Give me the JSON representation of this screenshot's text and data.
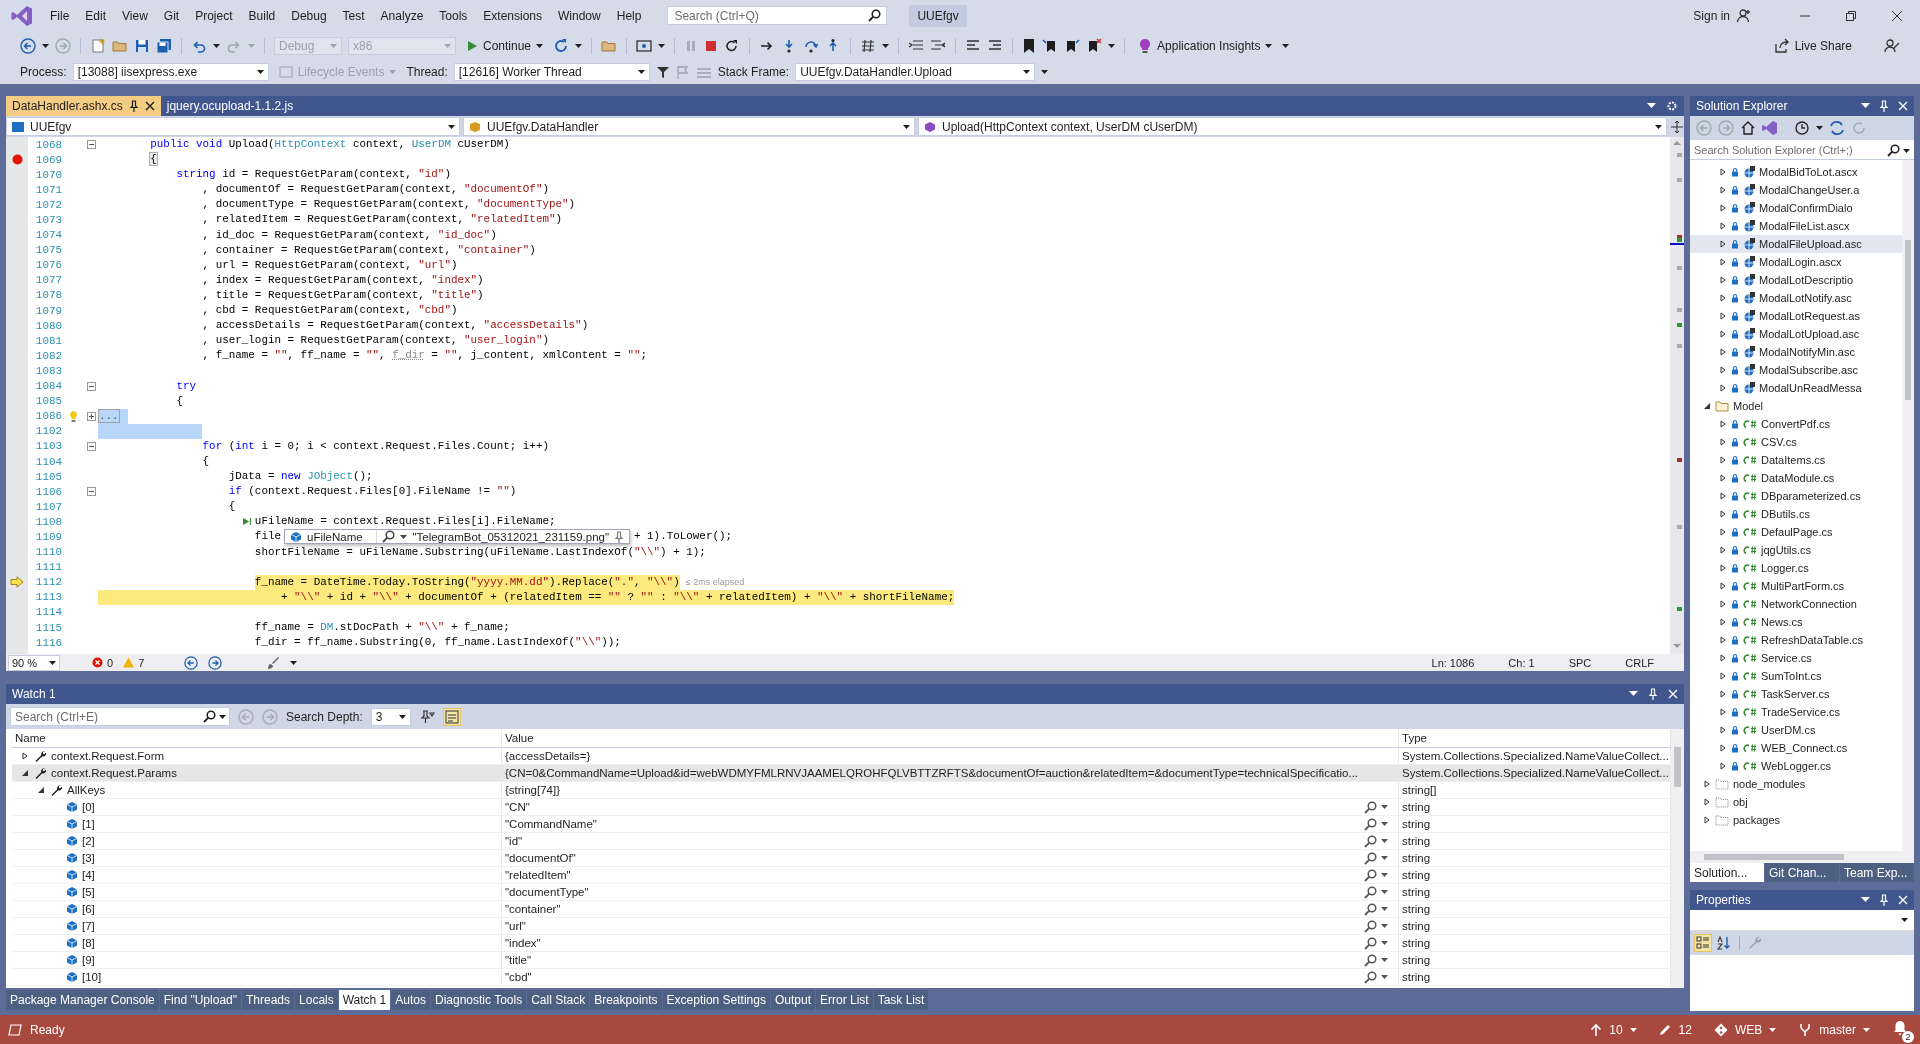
{
  "menubar": {
    "items": [
      "File",
      "Edit",
      "View",
      "Git",
      "Project",
      "Build",
      "Debug",
      "Test",
      "Analyze",
      "Tools",
      "Extensions",
      "Window",
      "Help"
    ],
    "search": {
      "placeholder": "Search (Ctrl+Q)"
    },
    "solution_name": "UUEfgv",
    "sign_in": "Sign in"
  },
  "toolbar": {
    "configuration": {
      "value": "Debug",
      "disabled": true
    },
    "platform": {
      "value": "x86",
      "disabled": true
    },
    "continue": "Continue",
    "application_insights": "Application Insights",
    "live_share": "Live Share"
  },
  "debug_location": {
    "process_label": "Process:",
    "process": "[13088] iisexpress.exe",
    "lifecycle_events": {
      "label": "Lifecycle Events",
      "disabled": true
    },
    "thread_label": "Thread:",
    "thread": "[12616] Worker Thread",
    "stack_frame_label": "Stack Frame:",
    "stack_frame": "UUEfgv.DataHandler.Upload"
  },
  "document_tabs": [
    {
      "label": "DataHandler.ashx.cs",
      "selected": true
    },
    {
      "label": "jquery.ocupload-1.1.2.js",
      "selected": false
    }
  ],
  "navigation_bar": [
    "UUEfgv",
    "UUEfgv.DataHandler",
    "Upload(HttpContext context, UserDM cUserDM)"
  ],
  "editor": {
    "lines": [
      {
        "number": "1068",
        "kind": "plain",
        "current": false,
        "selected": false,
        "expanded": true,
        "tokens": [
          {
            "kind": "k",
            "text": "        public void"
          },
          {
            "kind": "p",
            "text": " Upload("
          },
          {
            "kind": "t",
            "text": "HttpContext"
          },
          {
            "kind": "p",
            "text": " context, "
          },
          {
            "kind": "t",
            "text": "UserDM"
          },
          {
            "kind": "p",
            "text": " cUserDM)"
          }
        ]
      },
      {
        "number": "1069",
        "kind": "breakpoint",
        "current": false,
        "selected": false,
        "tokens": [
          {
            "kind": "m",
            "text": "        {"
          }
        ]
      },
      {
        "number": "1070",
        "kind": "plain",
        "current": false,
        "selected": false,
        "tokens": [
          {
            "kind": "k",
            "text": "            string"
          },
          {
            "kind": "p",
            "text": " id = RequestGetParam(context, "
          },
          {
            "kind": "s",
            "text": "\"id\""
          },
          {
            "kind": "p",
            "text": ")"
          }
        ]
      },
      {
        "number": "1071",
        "kind": "plain",
        "current": false,
        "selected": false,
        "tokens": [
          {
            "kind": "p",
            "text": "                , documentOf = RequestGetParam(context, "
          },
          {
            "kind": "s",
            "text": "\"documentOf\""
          },
          {
            "kind": "p",
            "text": ")"
          }
        ]
      },
      {
        "number": "1072",
        "kind": "plain",
        "current": false,
        "selected": false,
        "tokens": [
          {
            "kind": "p",
            "text": "                , documentType = RequestGetParam(context, "
          },
          {
            "kind": "s",
            "text": "\"documentType\""
          },
          {
            "kind": "p",
            "text": ")"
          }
        ]
      },
      {
        "number": "1073",
        "kind": "plain",
        "current": false,
        "selected": false,
        "tokens": [
          {
            "kind": "p",
            "text": "                , relatedItem = RequestGetParam(context, "
          },
          {
            "kind": "s",
            "text": "\"relatedItem\""
          },
          {
            "kind": "p",
            "text": ")"
          }
        ]
      },
      {
        "number": "1074",
        "kind": "plain",
        "current": false,
        "selected": false,
        "tokens": [
          {
            "kind": "p",
            "text": "                , id_doc = RequestGetParam(context, "
          },
          {
            "kind": "s",
            "text": "\"id_doc\""
          },
          {
            "kind": "p",
            "text": ")"
          }
        ]
      },
      {
        "number": "1075",
        "kind": "plain",
        "current": false,
        "selected": false,
        "tokens": [
          {
            "kind": "p",
            "text": "                , container = RequestGetParam(context, "
          },
          {
            "kind": "s",
            "text": "\"container\""
          },
          {
            "kind": "p",
            "text": ")"
          }
        ]
      },
      {
        "number": "1076",
        "kind": "plain",
        "current": false,
        "selected": false,
        "tokens": [
          {
            "kind": "p",
            "text": "                , url = RequestGetParam(context, "
          },
          {
            "kind": "s",
            "text": "\"url\""
          },
          {
            "kind": "p",
            "text": ")"
          }
        ]
      },
      {
        "number": "1077",
        "kind": "plain",
        "current": false,
        "selected": false,
        "tokens": [
          {
            "kind": "p",
            "text": "                , index = RequestGetParam(context, "
          },
          {
            "kind": "s",
            "text": "\"index\""
          },
          {
            "kind": "p",
            "text": ")"
          }
        ]
      },
      {
        "number": "1078",
        "kind": "plain",
        "current": false,
        "selected": false,
        "tokens": [
          {
            "kind": "p",
            "text": "                , title = RequestGetParam(context, "
          },
          {
            "kind": "s",
            "text": "\"title\""
          },
          {
            "kind": "p",
            "text": ")"
          }
        ]
      },
      {
        "number": "1079",
        "kind": "plain",
        "current": false,
        "selected": false,
        "tokens": [
          {
            "kind": "p",
            "text": "                , cbd = RequestGetParam(context, "
          },
          {
            "kind": "s",
            "text": "\"cbd\""
          },
          {
            "kind": "p",
            "text": ")"
          }
        ]
      },
      {
        "number": "1080",
        "kind": "plain",
        "current": false,
        "selected": false,
        "tokens": [
          {
            "kind": "p",
            "text": "                , accessDetails = RequestGetParam(context, "
          },
          {
            "kind": "s",
            "text": "\"accessDetails\""
          },
          {
            "kind": "p",
            "text": ")"
          }
        ]
      },
      {
        "number": "1081",
        "kind": "plain",
        "current": false,
        "selected": false,
        "tokens": [
          {
            "kind": "p",
            "text": "                , user_login = RequestGetParam(context, "
          },
          {
            "kind": "s",
            "text": "\"user_login\""
          },
          {
            "kind": "p",
            "text": ")"
          }
        ]
      },
      {
        "number": "1082",
        "kind": "plain",
        "current": false,
        "selected": false,
        "tokens": [
          {
            "kind": "p",
            "text": "                , f_name = "
          },
          {
            "kind": "s",
            "text": "\"\""
          },
          {
            "kind": "p",
            "text": ", ff_name = "
          },
          {
            "kind": "s",
            "text": "\"\""
          },
          {
            "kind": "p",
            "text": ", "
          },
          {
            "kind": "u",
            "text": "f_dir"
          },
          {
            "kind": "p",
            "text": " = "
          },
          {
            "kind": "s",
            "text": "\"\""
          },
          {
            "kind": "p",
            "text": ", j_content, xmlContent = "
          },
          {
            "kind": "s",
            "text": "\"\""
          },
          {
            "kind": "p",
            "text": ";"
          }
        ]
      },
      {
        "number": "1083",
        "kind": "plain",
        "current": false,
        "selected": false
      },
      {
        "number": "1084",
        "kind": "plain",
        "current": false,
        "selected": false,
        "expanded": true,
        "tokens": [
          {
            "kind": "k",
            "text": "            try"
          }
        ]
      },
      {
        "number": "1085",
        "kind": "plain",
        "current": false,
        "selected": false,
        "tokens": [
          {
            "kind": "p",
            "text": "            {"
          }
        ]
      },
      {
        "number": "1086",
        "kind": "lightbulb",
        "current": false,
        "selected": true,
        "expanded": false,
        "tokens": [
          {
            "kind": "c",
            "text": "..."
          }
        ]
      },
      {
        "number": "1102",
        "kind": "plain",
        "current": false,
        "selected": true
      },
      {
        "number": "1103",
        "kind": "plain",
        "current": false,
        "selected": false,
        "expanded": true,
        "tokens": [
          {
            "kind": "k",
            "text": "                for"
          },
          {
            "kind": "p",
            "text": " ("
          },
          {
            "kind": "k",
            "text": "int"
          },
          {
            "kind": "p",
            "text": " i = 0; i < context.Request.Files.Count; i++)"
          }
        ]
      },
      {
        "number": "1104",
        "kind": "plain",
        "current": false,
        "selected": false,
        "tokens": [
          {
            "kind": "p",
            "text": "                {"
          }
        ]
      },
      {
        "number": "1105",
        "kind": "plain",
        "current": false,
        "selected": false,
        "tokens": [
          {
            "kind": "p",
            "text": "                    jData = "
          },
          {
            "kind": "k",
            "text": "new "
          },
          {
            "kind": "t",
            "text": "JObject"
          },
          {
            "kind": "p",
            "text": "();"
          }
        ]
      },
      {
        "number": "1106",
        "kind": "plain",
        "current": false,
        "selected": false,
        "expanded": true,
        "tokens": [
          {
            "kind": "k",
            "text": "                    if"
          },
          {
            "kind": "p",
            "text": " (context.Request.Files[0].FileName != "
          },
          {
            "kind": "s",
            "text": "\"\""
          },
          {
            "kind": "p",
            "text": ")"
          }
        ]
      },
      {
        "number": "1107",
        "kind": "plain",
        "current": false,
        "selected": false,
        "tokens": [
          {
            "kind": "p",
            "text": "                    {"
          }
        ]
      },
      {
        "number": "1108",
        "kind": "run_to_click",
        "current": false,
        "selected": false,
        "tokens": [
          {
            "kind": "p",
            "text": "                        uFileName = context.Request.Files[i].FileName;"
          }
        ]
      },
      {
        "number": "1109",
        "kind": "plain",
        "current": false,
        "selected": false,
        "datatip": {
          "name": "uFileName",
          "value": "\"TelegramBot_05312021_231159.png\""
        },
        "tokens": [
          {
            "kind": "p",
            "text": "                        file"
          }
        ],
        "tail": "+ 1).ToLower();"
      },
      {
        "number": "1110",
        "kind": "plain",
        "current": false,
        "selected": false,
        "tokens": [
          {
            "kind": "p",
            "text": "                        shortFileName = uFileName.Substring(uFileName.LastIndexOf("
          },
          {
            "kind": "s",
            "text": "\"\\\\\""
          },
          {
            "kind": "p",
            "text": ") + 1);"
          }
        ]
      },
      {
        "number": "1111",
        "kind": "plain",
        "current": false,
        "selected": false
      },
      {
        "number": "1112",
        "kind": "current",
        "current": true,
        "selected": false,
        "perf_tip": "≤ 2ms elapsed",
        "tokens": [
          {
            "kind": "p",
            "text": "                        f_name = DateTime.Today.ToString("
          },
          {
            "kind": "s",
            "text": "\"yyyy.MM.dd\""
          },
          {
            "kind": "p",
            "text": ").Replace("
          },
          {
            "kind": "s",
            "text": "\".\""
          },
          {
            "kind": "p",
            "text": ", "
          },
          {
            "kind": "s",
            "text": "\"\\\\\""
          },
          {
            "kind": "p",
            "text": ")"
          }
        ]
      },
      {
        "number": "1113",
        "kind": "plain",
        "current": true,
        "selected": false,
        "tokens": [
          {
            "kind": "p",
            "text": "                            + "
          },
          {
            "kind": "s",
            "text": "\"\\\\\""
          },
          {
            "kind": "p",
            "text": " + id + "
          },
          {
            "kind": "s",
            "text": "\"\\\\\""
          },
          {
            "kind": "p",
            "text": " + documentOf + (relatedItem == "
          },
          {
            "kind": "s",
            "text": "\"\""
          },
          {
            "kind": "p",
            "text": " ? "
          },
          {
            "kind": "s",
            "text": "\"\""
          },
          {
            "kind": "p",
            "text": " : "
          },
          {
            "kind": "s",
            "text": "\"\\\\\""
          },
          {
            "kind": "p",
            "text": " + relatedItem) + "
          },
          {
            "kind": "s",
            "text": "\"\\\\\""
          },
          {
            "kind": "p",
            "text": " + shortFileName;"
          }
        ]
      },
      {
        "number": "1114",
        "kind": "plain",
        "current": false,
        "selected": false
      },
      {
        "number": "1115",
        "kind": "plain",
        "current": false,
        "selected": false,
        "tokens": [
          {
            "kind": "p",
            "text": "                        ff_name = "
          },
          {
            "kind": "t",
            "text": "DM"
          },
          {
            "kind": "p",
            "text": ".stDocPath + "
          },
          {
            "kind": "s",
            "text": "\"\\\\\""
          },
          {
            "kind": "p",
            "text": " + f_name;"
          }
        ]
      },
      {
        "number": "1116",
        "kind": "plain",
        "current": false,
        "selected": false,
        "tokens": [
          {
            "kind": "p",
            "text": "                        f_dir = ff_name.Substring(0, ff_name.LastIndexOf("
          },
          {
            "kind": "s",
            "text": "\"\\\\\""
          },
          {
            "kind": "p",
            "text": "));"
          }
        ]
      }
    ]
  },
  "editor_status": {
    "zoom": "90 %",
    "errors": "0",
    "warnings": "7",
    "line": "Ln: 1086",
    "column": "Ch: 1",
    "indent": "SPC",
    "line_ending": "CRLF"
  },
  "watch": {
    "title": "Watch 1",
    "search": {
      "placeholder": "Search (Ctrl+E)"
    },
    "search_depth_label": "Search Depth:",
    "search_depth": "3",
    "columns": [
      "Name",
      "Value",
      "Type"
    ],
    "rows": [
      {
        "kind": "property",
        "name": "context.Request.Form",
        "value": "{accessDetails=}",
        "type": "System.Collections.Specialized.NameValueCollect...",
        "expanded": false,
        "selected": false
      },
      {
        "kind": "property",
        "name": "context.Request.Params",
        "value": "{CN=0&CommandName=Upload&id=webWDMYFMLRNVJAAMELQROHFQLVBTTZRFTS&documentOf=auction&relatedItem=&documentType=technicalSpecificatio...",
        "type": "System.Collections.Specialized.NameValueCollect...",
        "expanded": true,
        "selected": true,
        "children": [
          {
            "kind": "property",
            "name": "AllKeys",
            "value": "{string[74]}",
            "type": "string[]",
            "expanded": true,
            "selected": false,
            "children": [
              {
                "kind": "item",
                "name": "[0]",
                "value": "\"CN\"",
                "type": "string",
                "selected": false
              },
              {
                "kind": "item",
                "name": "[1]",
                "value": "\"CommandName\"",
                "type": "string",
                "selected": false
              },
              {
                "kind": "item",
                "name": "[2]",
                "value": "\"id\"",
                "type": "string",
                "selected": false
              },
              {
                "kind": "item",
                "name": "[3]",
                "value": "\"documentOf\"",
                "type": "string",
                "selected": false
              },
              {
                "kind": "item",
                "name": "[4]",
                "value": "\"relatedItem\"",
                "type": "string",
                "selected": false
              },
              {
                "kind": "item",
                "name": "[5]",
                "value": "\"documentType\"",
                "type": "string",
                "selected": false
              },
              {
                "kind": "item",
                "name": "[6]",
                "value": "\"container\"",
                "type": "string",
                "selected": false
              },
              {
                "kind": "item",
                "name": "[7]",
                "value": "\"url\"",
                "type": "string",
                "selected": false
              },
              {
                "kind": "item",
                "name": "[8]",
                "value": "\"index\"",
                "type": "string",
                "selected": false
              },
              {
                "kind": "item",
                "name": "[9]",
                "value": "\"title\"",
                "type": "string",
                "selected": false
              },
              {
                "kind": "item",
                "name": "[10]",
                "value": "\"cbd\"",
                "type": "string",
                "selected": false
              }
            ]
          }
        ]
      }
    ]
  },
  "tool_tabs": [
    {
      "label": "Package Manager Console",
      "selected": false
    },
    {
      "label": "Find \"Upload\"",
      "selected": false
    },
    {
      "label": "Threads",
      "selected": false
    },
    {
      "label": "Locals",
      "selected": false
    },
    {
      "label": "Watch 1",
      "selected": true
    },
    {
      "label": "Autos",
      "selected": false
    },
    {
      "label": "Diagnostic Tools",
      "selected": false
    },
    {
      "label": "Call Stack",
      "selected": false
    },
    {
      "label": "Breakpoints",
      "selected": false
    },
    {
      "label": "Exception Settings",
      "selected": false
    },
    {
      "label": "Output",
      "selected": false
    },
    {
      "label": "Error List",
      "selected": false
    },
    {
      "label": "Task List",
      "selected": false
    }
  ],
  "solution_explorer": {
    "title": "Solution Explorer",
    "search": {
      "placeholder": "Search Solution Explorer (Ctrl+;)"
    },
    "tree": [
      {
        "children": [
          {
            "kind": "control",
            "label": "ModalBidToLot.ascx",
            "expanded": false,
            "selected": false
          },
          {
            "kind": "control",
            "label": "ModalChangeUser.a",
            "expanded": false,
            "selected": false
          },
          {
            "kind": "control",
            "label": "ModalConfirmDialo",
            "expanded": false,
            "selected": false
          },
          {
            "kind": "control",
            "label": "ModalFileList.ascx",
            "expanded": false,
            "selected": false
          },
          {
            "kind": "control",
            "label": "ModalFileUpload.asc",
            "expanded": false,
            "selected": true
          },
          {
            "kind": "control",
            "label": "ModalLogin.ascx",
            "expanded": false,
            "selected": false
          },
          {
            "kind": "control",
            "label": "ModalLotDescriptio",
            "expanded": false,
            "selected": false
          },
          {
            "kind": "control",
            "label": "ModalLotNotify.asc",
            "expanded": false,
            "selected": false
          },
          {
            "kind": "control",
            "label": "ModalLotRequest.as",
            "expanded": false,
            "selected": false
          },
          {
            "kind": "control",
            "label": "ModalLotUpload.asc",
            "expanded": false,
            "selected": false
          },
          {
            "kind": "control",
            "label": "ModalNotifyMin.asc",
            "expanded": false,
            "selected": false
          },
          {
            "kind": "control",
            "label": "ModalSubscribe.asc",
            "expanded": false,
            "selected": false
          },
          {
            "kind": "control",
            "label": "ModalUnReadMessa",
            "expanded": false,
            "selected": false
          }
        ]
      },
      {
        "kind": "folder",
        "label": "Model",
        "expanded": true,
        "selected": false,
        "children": [
          {
            "kind": "csharp",
            "label": "ConvertPdf.cs",
            "expanded": false,
            "selected": false
          },
          {
            "kind": "csharp",
            "label": "CSV.cs",
            "expanded": false,
            "selected": false
          },
          {
            "kind": "csharp",
            "label": "DataItems.cs",
            "expanded": false,
            "selected": false
          },
          {
            "kind": "csharp",
            "label": "DataModule.cs",
            "expanded": false,
            "selected": false
          },
          {
            "kind": "csharp",
            "label": "DBparameterized.cs",
            "expanded": false,
            "selected": false
          },
          {
            "kind": "csharp",
            "label": "DButils.cs",
            "expanded": false,
            "selected": false
          },
          {
            "kind": "csharp",
            "label": "DefaulPage.cs",
            "expanded": false,
            "selected": false
          },
          {
            "kind": "csharp",
            "label": "jqgUtils.cs",
            "expanded": false,
            "selected": false
          },
          {
            "kind": "csharp",
            "label": "Logger.cs",
            "expanded": false,
            "selected": false
          },
          {
            "kind": "csharp",
            "label": "MultiPartForm.cs",
            "expanded": false,
            "selected": false
          },
          {
            "kind": "csharp",
            "label": "NetworkConnection",
            "expanded": false,
            "selected": false
          },
          {
            "kind": "csharp",
            "label": "News.cs",
            "expanded": false,
            "selected": false
          },
          {
            "kind": "csharp",
            "label": "RefreshDataTable.cs",
            "expanded": false,
            "selected": false
          },
          {
            "kind": "csharp",
            "label": "Service.cs",
            "expanded": false,
            "selected": false
          },
          {
            "kind": "csharp",
            "label": "SumToInt.cs",
            "expanded": false,
            "selected": false
          },
          {
            "kind": "csharp",
            "label": "TaskServer.cs",
            "expanded": false,
            "selected": false
          },
          {
            "kind": "csharp",
            "label": "TradeService.cs",
            "expanded": false,
            "selected": false
          },
          {
            "kind": "csharp",
            "label": "UserDM.cs",
            "expanded": false,
            "selected": false
          },
          {
            "kind": "csharp",
            "label": "WEB_Connect.cs",
            "expanded": false,
            "selected": false
          },
          {
            "kind": "csharp",
            "label": "WebLogger.cs",
            "expanded": false,
            "selected": false
          }
        ]
      },
      {
        "kind": "excluded_folder",
        "label": "node_modules",
        "expanded": false,
        "selected": false
      },
      {
        "kind": "excluded_folder",
        "label": "obj",
        "expanded": false,
        "selected": false
      },
      {
        "kind": "excluded_folder",
        "label": "packages",
        "expanded": false,
        "selected": false
      }
    ],
    "tabs": [
      {
        "label": "Solution...",
        "selected": true
      },
      {
        "label": "Git Chan...",
        "selected": false
      },
      {
        "label": "Team Exp...",
        "selected": false
      }
    ]
  },
  "properties": {
    "title": "Properties"
  },
  "status_bar": {
    "message": "Ready",
    "publish": "10",
    "changes": "12",
    "repository": "WEB",
    "branch": "master",
    "notifications": "2"
  }
}
